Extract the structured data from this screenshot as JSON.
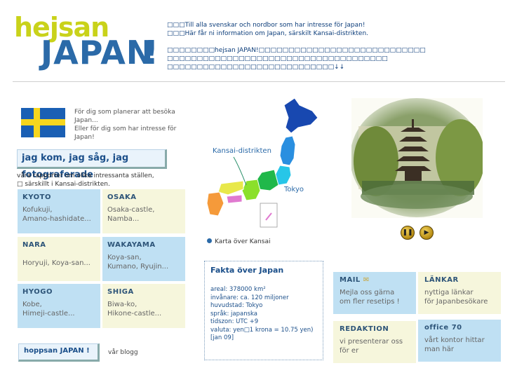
{
  "logo": {
    "hejsan": "hejsan",
    "japan": "JAPAN",
    "bang": "!"
  },
  "intro": {
    "line1": "□□□Till alla svenskar och nordbor som har intresse för Japan!",
    "line2": "□□□Här får ni information om Japan, särskilt Kansai-distrikten.",
    "line3": "□□□□□□□□hejsan JAPAN!□□□□□□□□□□□□□□□□□□□□□□□□□□□□",
    "line4": "□□□□□□□□□□□□□□□□□□□□□□□□□□□□□□□□□□□□□",
    "line5": "□□□□□□□□□□□□□□□□□□□□□□□□□□□□↓↓"
  },
  "left": {
    "for_you": [
      "För dig som planerar att besöka",
      "Japan...",
      "Eller för dig som har intresse för",
      "Japan!"
    ],
    "reports_button": "jag kom, jag såg, jag fotograferade",
    "reports_desc": [
      "våra rapporter om olika intressanta ställen,",
      "□ särskillt i Kansai-distrikten."
    ],
    "tiles": [
      {
        "title": "KYOTO",
        "desc": [
          "Kofukuji,",
          "Amano-hashidate..."
        ]
      },
      {
        "title": "OSAKA",
        "desc": [
          "Osaka-castle,",
          "Namba..."
        ]
      },
      {
        "title": "NARA",
        "desc": [
          "Horyuji, Koya-san..."
        ]
      },
      {
        "title": "WAKAYAMA",
        "desc": [
          "Koya-san,",
          "Kumano, Ryujin..."
        ]
      },
      {
        "title": "HYOGO",
        "desc": [
          "Kobe,",
          "Himeji-castle..."
        ]
      },
      {
        "title": "SHIGA",
        "desc": [
          "Biwa-ko,",
          "Hikone-castle..."
        ]
      }
    ],
    "blog_button": "hoppsan JAPAN !",
    "blog_label": "vår blogg"
  },
  "map": {
    "kansai_label": "Kansai-distrikten",
    "tokyo_label": "Tokyo",
    "link": "Karta över Kansai"
  },
  "facts": {
    "title": "Fakta över Japan",
    "lines": [
      "areal: 378000 km²",
      "invånare: ca. 120 miljoner",
      "huvudstad: Tokyo",
      "språk: japanska",
      "tidszon: UTC +9",
      "valuta: yen□1 krona = 10.75 yen)",
      "[jan 09]"
    ]
  },
  "right": {
    "tiles": [
      {
        "title": "MAIL",
        "desc": [
          "Mejla oss gärna",
          "om fler resetips !"
        ]
      },
      {
        "title": "LÄNKAR",
        "desc": [
          "nyttiga länkar",
          "för Japanbesökare"
        ]
      },
      {
        "title": "REDAKTION",
        "desc": [
          "vi presenterar oss",
          "för er"
        ]
      },
      {
        "title": "office 70",
        "desc": [
          "vårt kontor hittar",
          "man här"
        ]
      }
    ]
  },
  "colors": {
    "blue_tile": "#bfe0f3",
    "cream_tile": "#f6f6dc",
    "brand_blue": "#2b6aa8",
    "logo_yellow": "#c9d21a"
  }
}
